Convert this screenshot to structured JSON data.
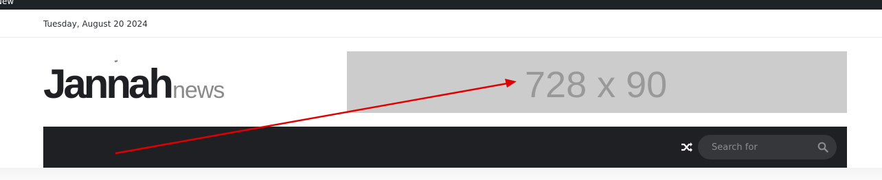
{
  "admin_bar": {
    "label": "New"
  },
  "topbar": {
    "date": "Tuesday, August 20 2024"
  },
  "logo": {
    "main": "Jannah",
    "suffix": "news",
    "mark": "ّ"
  },
  "ad": {
    "text": "728 x 90"
  },
  "nav": {
    "shuffle_icon": "random-shuffle-icon",
    "search_placeholder": "Search for",
    "search_icon": "search-icon"
  },
  "colors": {
    "admin_bar": "#1d2327",
    "nav_bg": "#1f2024",
    "search_bg": "#35373b",
    "ad_bg": "#cccccc",
    "ad_text": "#999999",
    "annotation_arrow": "#e00000"
  }
}
